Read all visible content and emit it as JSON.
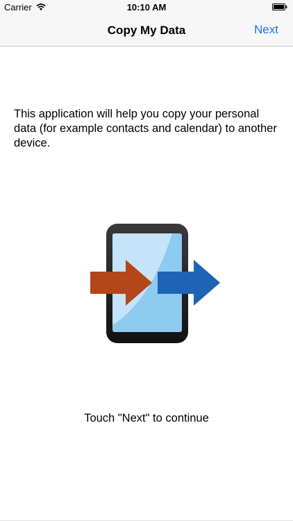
{
  "status_bar": {
    "carrier": "Carrier",
    "time": "10:10 AM"
  },
  "nav": {
    "title": "Copy My Data",
    "next_label": "Next"
  },
  "content": {
    "intro": "This application will help you copy your personal data (for example contacts and calendar) to another device.",
    "hint": "Touch \"Next\" to continue"
  },
  "icons": {
    "wifi": "wifi-icon",
    "battery": "battery-icon",
    "illustration": "phone-transfer-icon"
  },
  "colors": {
    "accent": "#1a73e8",
    "arrow_in": "#b5461a",
    "arrow_out": "#1e64b4",
    "screen": "#8fcaf0"
  }
}
